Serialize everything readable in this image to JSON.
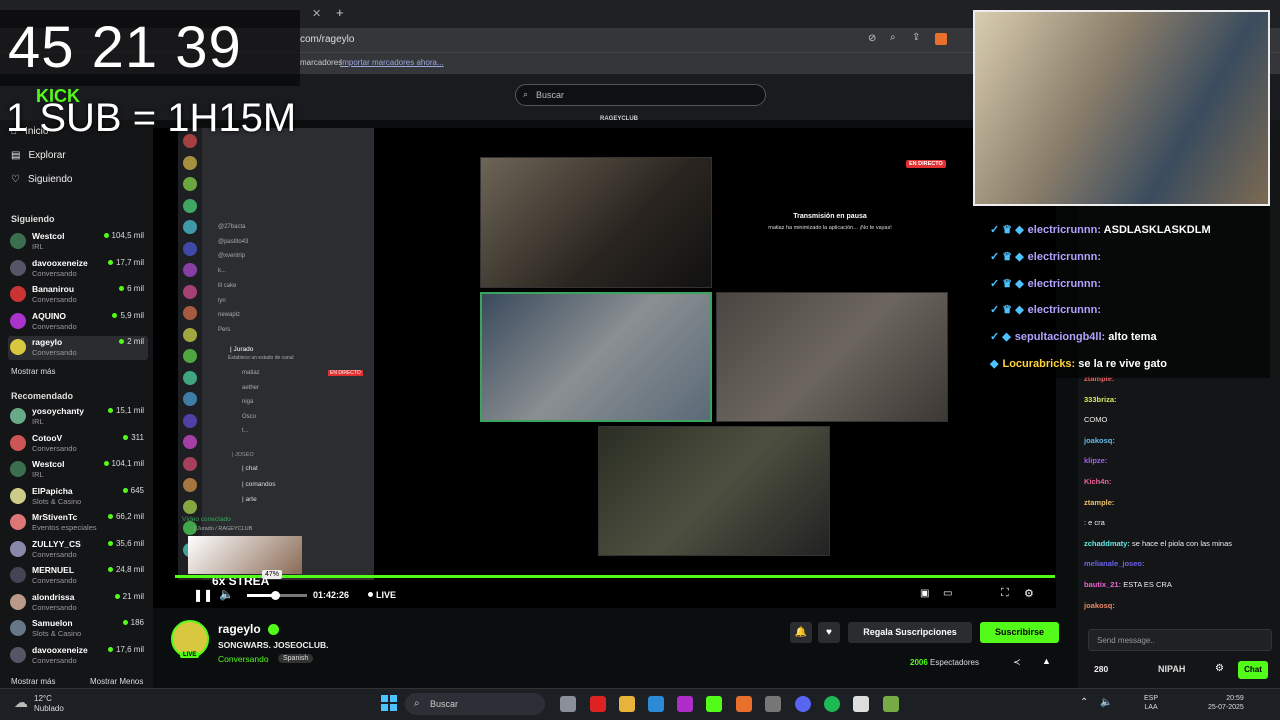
{
  "browser": {
    "url": "com/rageylo",
    "bookmarks_text": "marcadores",
    "bookmarks_link": "Importar marcadores ahora..."
  },
  "kick": {
    "search_placeholder": "Buscar",
    "nav": [
      {
        "label": "Inicio"
      },
      {
        "label": "Explorar"
      },
      {
        "label": "Siguiendo"
      }
    ],
    "following_title": "Siguiendo",
    "following": [
      {
        "name": "Westcol",
        "cat": "IRL",
        "viewers": "104,5 mil",
        "color": "#3a6e4e"
      },
      {
        "name": "davooxeneize",
        "cat": "Conversando",
        "viewers": "17,7 mil",
        "color": "#556"
      },
      {
        "name": "Bananirou",
        "cat": "Conversando",
        "viewers": "6 mil",
        "color": "#c33"
      },
      {
        "name": "AQUINO",
        "cat": "Conversando",
        "viewers": "5,9 mil",
        "color": "#a3c"
      },
      {
        "name": "rageylo",
        "cat": "Conversando",
        "viewers": "2 mil",
        "color": "#d8c840"
      }
    ],
    "show_more": "Mostrar más",
    "recommended_title": "Recomendado",
    "recommended": [
      {
        "name": "yosoychanty",
        "cat": "IRL",
        "viewers": "15,1 mil",
        "color": "#6a8"
      },
      {
        "name": "CotooV",
        "cat": "Conversando",
        "viewers": "311",
        "color": "#c55"
      },
      {
        "name": "Westcol",
        "cat": "IRL",
        "viewers": "104,1 mil",
        "color": "#3a6e4e"
      },
      {
        "name": "ElPapicha",
        "cat": "Slots & Casino",
        "viewers": "645",
        "color": "#cc8"
      },
      {
        "name": "MrStivenTc",
        "cat": "Eventos especiales",
        "viewers": "66,2 mil",
        "color": "#d77"
      },
      {
        "name": "ZULLYY_CS",
        "cat": "Conversando",
        "viewers": "35,6 mil",
        "color": "#88a"
      },
      {
        "name": "MERNUEL",
        "cat": "Conversando",
        "viewers": "24,8 mil",
        "color": "#445"
      },
      {
        "name": "alondrissa",
        "cat": "Conversando",
        "viewers": "21 mil",
        "color": "#b98"
      },
      {
        "name": "Samuelon",
        "cat": "Slots & Casino",
        "viewers": "186",
        "color": "#678"
      },
      {
        "name": "davooxeneize",
        "cat": "Conversando",
        "viewers": "17,6 mil",
        "color": "#556"
      }
    ],
    "show_more2": "Mostrar más",
    "show_less": "Mostrar Menos"
  },
  "stream": {
    "club_label": "RAGEYCLUB",
    "paused_title": "Transmisión en pausa",
    "paused_sub": "matiaz ha minimizado la aplicación... ¡No te vayas!",
    "live_badge": "EN DIRECTO",
    "time": "01:42:26",
    "live": "LIVE",
    "volume_tip": "47%",
    "volume": 0.47
  },
  "discord": {
    "users": [
      "@27bacta",
      "@pastito43",
      "@xventrip",
      "k...",
      "lil cake",
      "lyn",
      "newaplz",
      "Pers"
    ],
    "channel_jurado": "| Jurado",
    "jurado_sub": "Establece un estado de canal",
    "jurado_users": [
      "matiaz",
      "aether",
      "niga",
      "Osco",
      "t..."
    ],
    "section": "| JOSEO",
    "channels": [
      "| chat",
      "| comandos",
      "| arte"
    ],
    "voice_connected": "Vídeo conectado",
    "voice_sub": "| Jurado / RAGEYCLUB",
    "live_badge": "EN DIRECTO"
  },
  "channel": {
    "name": "rageylo",
    "title": "SONGWARS. JOSEOCLUB.",
    "category": "Conversando",
    "language": "Spanish",
    "live_tag": "LIVE",
    "gift_label": "Regala Suscripciones",
    "subscribe_label": "Suscribirse",
    "viewers_count": "2006",
    "viewers_label": "Espectadores"
  },
  "chat": {
    "messages": [
      {
        "user": "ztample:",
        "text": ""
      },
      {
        "user": "333briza:",
        "text": ""
      },
      {
        "user": "",
        "text": "COMO"
      },
      {
        "user": "joakosq:",
        "text": ""
      },
      {
        "user": "klipze:",
        "text": ""
      },
      {
        "user": "Kich4n:",
        "text": ""
      },
      {
        "user": "ztample:",
        "text": ""
      },
      {
        "user": "",
        "text": ": e cra"
      },
      {
        "user": "zchaddmaty:",
        "text": "se hace el piola con las minas"
      },
      {
        "user": "melianale_joseo:",
        "text": ""
      },
      {
        "user": "bautix_21:",
        "text": "ESTA ES CRA"
      },
      {
        "user": "joakosq:",
        "text": ""
      }
    ],
    "send_placeholder": "Send message..",
    "points": "280",
    "chat_button": "Chat",
    "brand": "NIPAH"
  },
  "overlay": {
    "timer": "45 21 39",
    "sub_rule": "1 SUB = 1H15M",
    "chat": [
      {
        "user": "electricrunnn:",
        "text": "ASDLASKLASKDLM"
      },
      {
        "user": "electricrunnn:",
        "text": ""
      },
      {
        "user": "electricrunnn:",
        "text": ""
      },
      {
        "user": "electricrunnn:",
        "text": ""
      },
      {
        "user": "sepultaciongb4ll:",
        "text": "alto tema"
      },
      {
        "user": "Locurabricks:",
        "text": "se la re vive gato"
      }
    ],
    "stream_text": "6x STREA"
  },
  "taskbar": {
    "temp": "12°C",
    "weather": "Nublado",
    "search": "Buscar",
    "lang1": "ESP",
    "lang2": "LAA",
    "time": "20:59",
    "date": "25-07-2025"
  }
}
